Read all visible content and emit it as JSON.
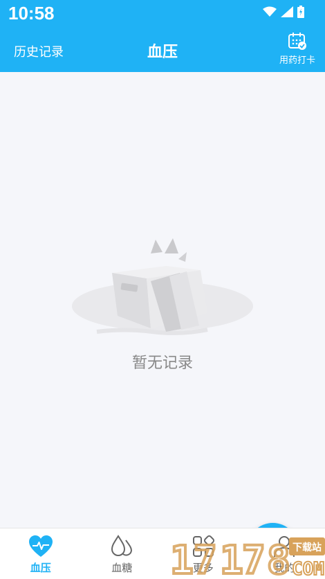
{
  "status_bar": {
    "time": "10:58"
  },
  "header": {
    "left_label": "历史记录",
    "title": "血压",
    "right_label": "用药打卡",
    "right_icon": "calendar-check-icon"
  },
  "content": {
    "empty_text": "暂无记录"
  },
  "fab": {
    "icon": "plus-icon"
  },
  "tabs": [
    {
      "label": "血压",
      "icon": "heart-pulse-icon",
      "active": true
    },
    {
      "label": "血糖",
      "icon": "drops-icon",
      "active": false
    },
    {
      "label": "更多",
      "icon": "grid-icon",
      "active": false
    },
    {
      "label": "我的",
      "icon": "user-icon",
      "active": false
    }
  ],
  "colors": {
    "primary": "#1fb2f5",
    "background": "#f5f6fa",
    "text_muted": "#888888"
  }
}
